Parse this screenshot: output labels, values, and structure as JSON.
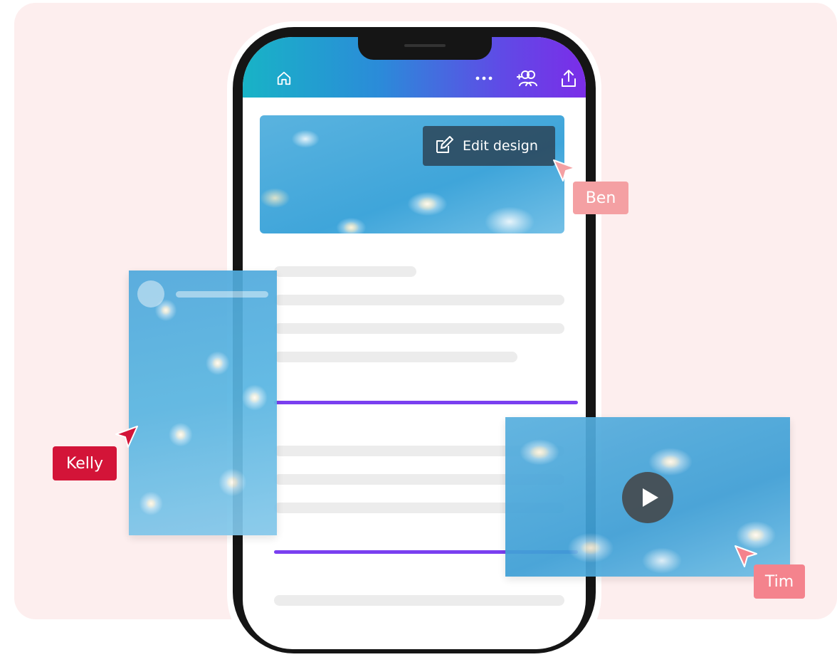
{
  "topbar": {
    "home_icon": "home-icon",
    "more_icon": "more-horizontal-icon",
    "share_people_icon": "add-people-icon",
    "upload_icon": "upload-icon"
  },
  "hero": {
    "edit_button_label": "Edit design",
    "edit_icon": "pencil-edit-icon"
  },
  "collaborators": [
    {
      "name": "Ben",
      "color": "#f4a0a3"
    },
    {
      "name": "Kelly",
      "color": "#d31438"
    },
    {
      "name": "Tim",
      "color": "#f4838d"
    }
  ],
  "video_card": {
    "play_icon": "play-icon"
  },
  "colors": {
    "accent_purple": "#7a3ff0",
    "stage_bg": "#fdeeee"
  }
}
